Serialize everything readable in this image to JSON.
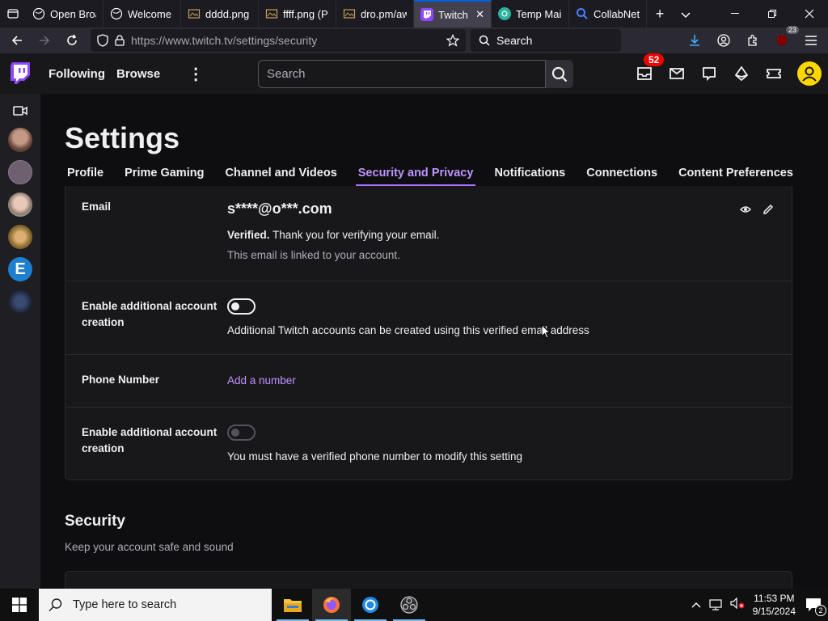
{
  "browser": {
    "tabs": [
      {
        "title": "Open Broa",
        "favicon": "globe-icon",
        "active": false
      },
      {
        "title": "Welcome",
        "favicon": "globe-icon",
        "active": false
      },
      {
        "title": "dddd.png",
        "favicon": "image-icon",
        "active": false
      },
      {
        "title": "ffff.png (P",
        "favicon": "image-icon",
        "active": false
      },
      {
        "title": "dro.pm/aw",
        "favicon": "image-icon",
        "active": false
      },
      {
        "title": "Twitch",
        "favicon": "twitch-icon",
        "active": true
      },
      {
        "title": "Temp Mail",
        "favicon": "tempmail-icon",
        "active": false
      },
      {
        "title": "CollabNet",
        "favicon": "search-icon",
        "active": false
      }
    ],
    "url": "https://www.twitch.tv/settings/security",
    "search_placeholder": "Search",
    "extension_badge": "23"
  },
  "twitch_nav": {
    "following": "Following",
    "browse": "Browse",
    "search_placeholder": "Search",
    "notification_count": "52"
  },
  "settings": {
    "title": "Settings",
    "tabs": [
      "Profile",
      "Prime Gaming",
      "Channel and Videos",
      "Security and Privacy",
      "Notifications",
      "Connections",
      "Content Preferences"
    ],
    "active_tab": "Security and Privacy",
    "email": {
      "label": "Email",
      "value": "s****@o***.com",
      "verified_bold": "Verified.",
      "verified_text": " Thank you for verifying your email.",
      "linked_text": "This email is linked to your account."
    },
    "email_additional": {
      "label": "Enable additional account creation",
      "desc": "Additional Twitch accounts can be created using this verified email address"
    },
    "phone": {
      "label": "Phone Number",
      "link": "Add a number"
    },
    "phone_additional": {
      "label": "Enable additional account creation",
      "desc": "You must have a verified phone number to modify this setting"
    },
    "security": {
      "title": "Security",
      "subtitle": "Keep your account safe and sound"
    }
  },
  "taskbar": {
    "search_placeholder": "Type here to search",
    "time": "11:53 PM",
    "date": "9/15/2024",
    "notification_count": "2"
  },
  "colors": {
    "twitch_purple": "#9146ff",
    "accent_purple": "#bf94ff",
    "notif_red": "#eb0400",
    "avatar_yellow": "#ffd600"
  }
}
